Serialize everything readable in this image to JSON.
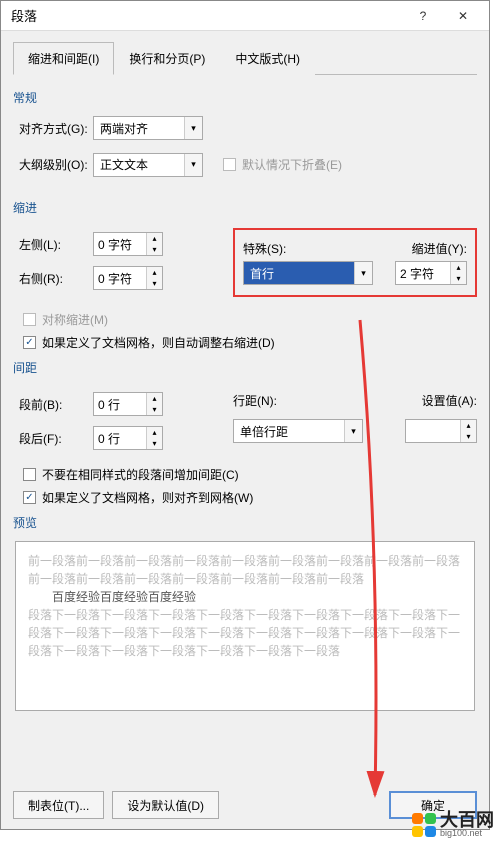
{
  "titlebar": {
    "title": "段落"
  },
  "tabs": {
    "t1": "缩进和间距(I)",
    "t2": "换行和分页(P)",
    "t3": "中文版式(H)"
  },
  "sections": {
    "general": "常规",
    "indent": "缩进",
    "spacing": "间距",
    "preview": "预览"
  },
  "general": {
    "align_label": "对齐方式(G):",
    "align_value": "两端对齐",
    "outline_label": "大纲级别(O):",
    "outline_value": "正文文本",
    "collapse_label": "默认情况下折叠(E)"
  },
  "indent": {
    "left_label": "左侧(L):",
    "left_value": "0 字符",
    "right_label": "右侧(R):",
    "right_value": "0 字符",
    "special_label": "特殊(S):",
    "special_value": "首行",
    "indentval_label": "缩进值(Y):",
    "indentval_value": "2 字符",
    "mirror_label": "对称缩进(M)",
    "grid_label": "如果定义了文档网格，则自动调整右缩进(D)"
  },
  "spacing": {
    "before_label": "段前(B):",
    "before_value": "0 行",
    "after_label": "段后(F):",
    "after_value": "0 行",
    "linespace_label": "行距(N):",
    "linespace_value": "单倍行距",
    "setat_label": "设置值(A):",
    "setat_value": "",
    "nospace_label": "不要在相同样式的段落间增加间距(C)",
    "snap_label": "如果定义了文档网格，则对齐到网格(W)"
  },
  "preview": {
    "light1": "前一段落前一段落前一段落前一段落前一段落前一段落前一段落前一段落前一段落前一段落前一段落前一段落前一段落前一段落前一段落前一段落",
    "dark": "百度经验百度经验百度经验",
    "light2": "段落下一段落下一段落下一段落下一段落下一段落下一段落下一段落下一段落下一段落下一段落下一段落下一段落下一段落下一段落下一段落下一段落下一段落下一段落下一段落下一段落下一段落下一段落下一段落下一段落"
  },
  "buttons": {
    "tabs": "制表位(T)...",
    "default": "设为默认值(D)",
    "ok": "确定"
  },
  "watermark": {
    "name": "大百网",
    "url": "big100.net"
  }
}
